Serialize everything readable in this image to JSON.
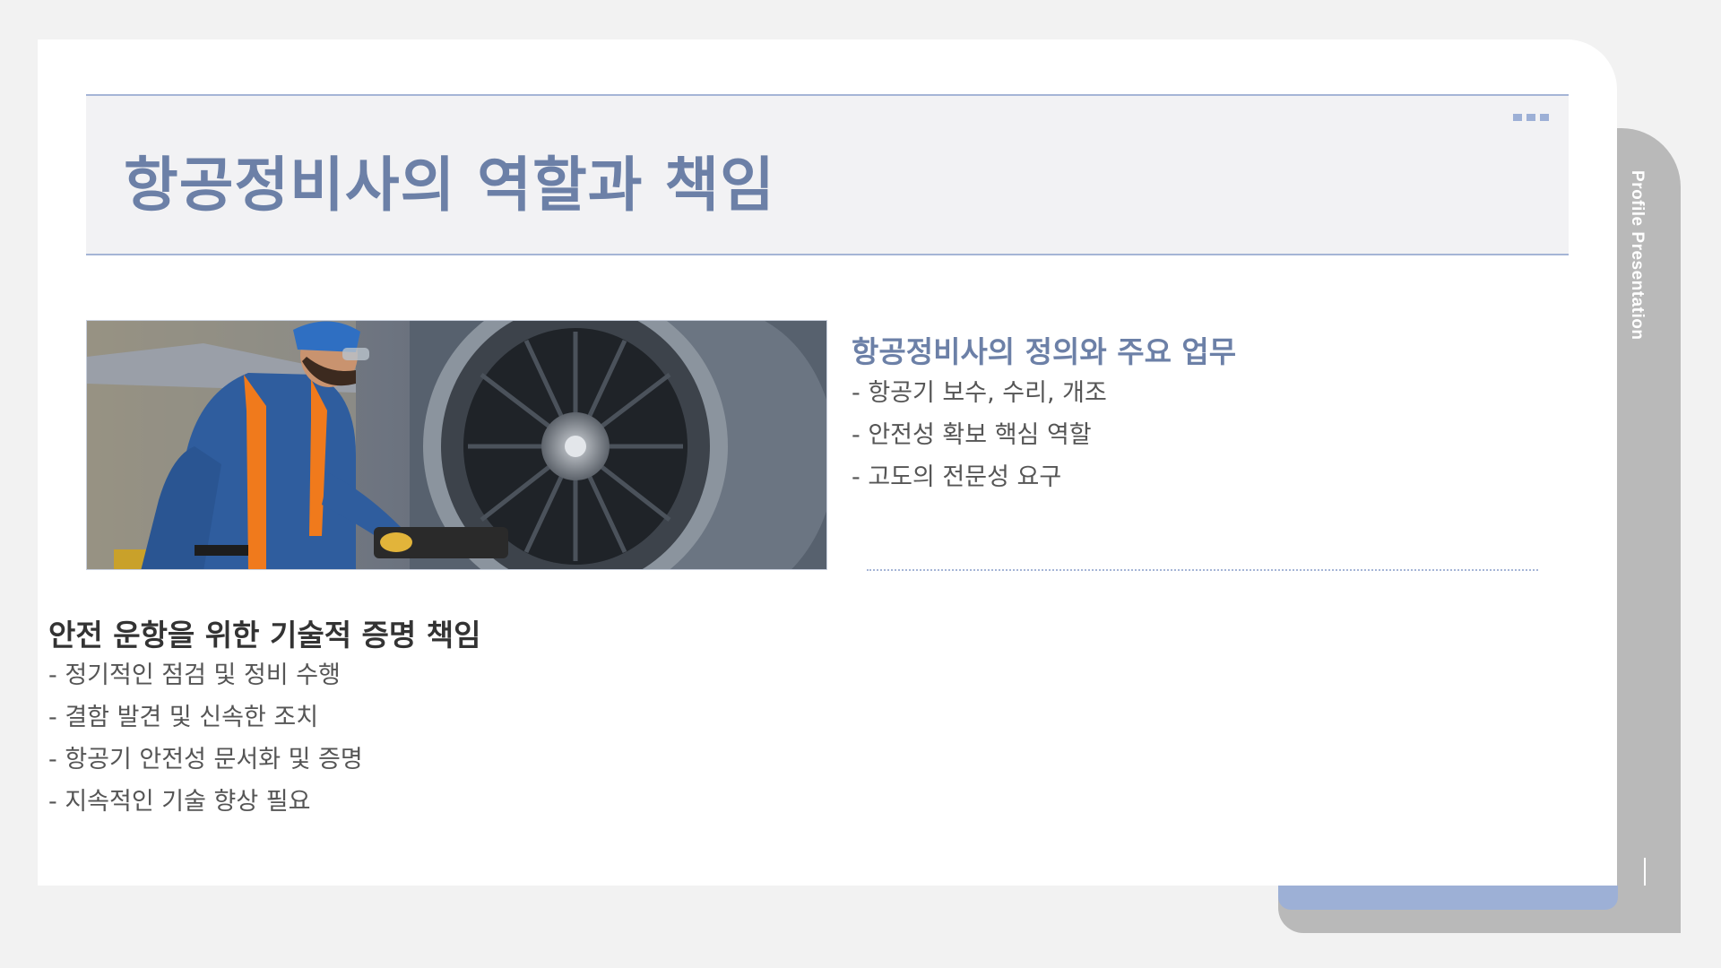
{
  "side_tab": {
    "label": "Profile Presentation"
  },
  "title": "항공정비사의 역할과 책임",
  "photo": {
    "alt": "aircraft-mechanic-inspecting-jet-engine"
  },
  "section1": {
    "heading": "항공정비사의 정의와 주요 업무",
    "bullets": [
      "- 항공기 보수, 수리, 개조",
      "- 안전성 확보 핵심 역할",
      "- 고도의 전문성 요구"
    ]
  },
  "section2": {
    "heading": "안전 운항을 위한 기술적 증명 책임",
    "bullets": [
      "- 정기적인 점검 및 정비 수행",
      "- 결함 발견 및 신속한 조치",
      "- 항공기 안전성 문서화 및 증명",
      "- 지속적인 기술 향상 필요"
    ]
  },
  "colors": {
    "accent": "#6c80a7",
    "accent_light": "#9db0d6",
    "tab_gray": "#b9b9b9",
    "background": "#f2f2f2"
  },
  "icons": [
    "more-dots-icon",
    "down-arrow-icon"
  ]
}
